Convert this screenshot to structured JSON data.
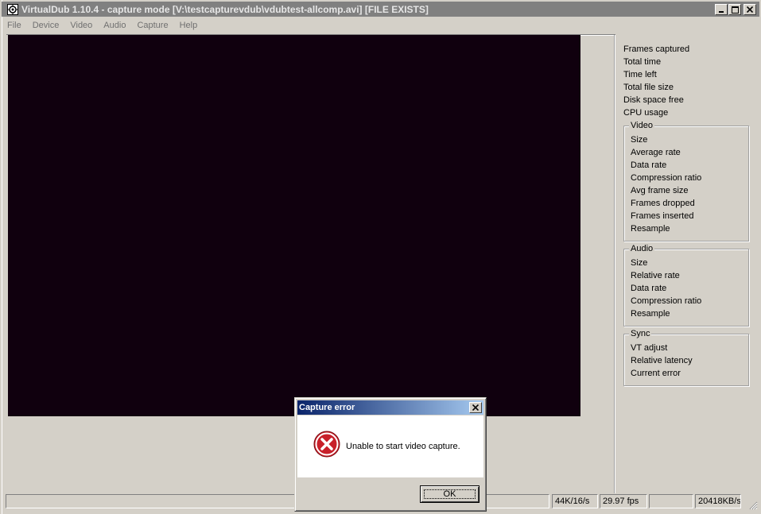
{
  "window": {
    "title": "VirtualDub 1.10.4 - capture mode [V:\\testcapturevdub\\vdubtest-allcomp.avi] [FILE EXISTS]"
  },
  "menu": {
    "items": [
      "File",
      "Device",
      "Video",
      "Audio",
      "Capture",
      "Help"
    ]
  },
  "stats": {
    "general": [
      "Frames captured",
      "Total time",
      "Time left",
      "Total file size",
      "Disk space free",
      "CPU usage"
    ],
    "video": {
      "title": "Video",
      "items": [
        "Size",
        "Average rate",
        "Data rate",
        "Compression ratio",
        "Avg frame size",
        "Frames dropped",
        "Frames inserted",
        "Resample"
      ]
    },
    "audio": {
      "title": "Audio",
      "items": [
        "Size",
        "Relative rate",
        "Data rate",
        "Compression ratio",
        "Resample"
      ]
    },
    "sync": {
      "title": "Sync",
      "items": [
        "VT adjust",
        "Relative latency",
        "Current error"
      ]
    }
  },
  "statusbar": {
    "main": "",
    "audio_format": "44K/16/s",
    "fps": "29.97 fps",
    "blank": "",
    "data_rate": "20418KB/s"
  },
  "dialog": {
    "title": "Capture error",
    "message": "Unable to start video capture.",
    "ok_label": "OK"
  },
  "colors": {
    "title_inactive": "#808080",
    "dialog_title_start": "#0a246a",
    "dialog_title_end": "#a6caf0",
    "face": "#d4d0c8",
    "video_bg": "#10000e",
    "error_red": "#c8202a"
  }
}
